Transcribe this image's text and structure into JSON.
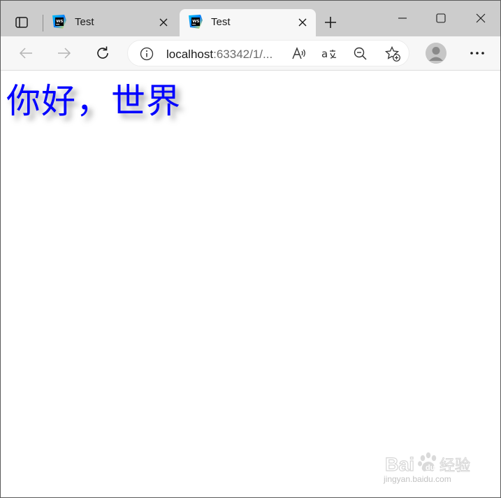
{
  "browser": {
    "tabs": [
      {
        "title": "Test",
        "active": false
      },
      {
        "title": "Test",
        "active": true
      }
    ],
    "address_bar": {
      "url_host": "localhost",
      "url_rest": ":63342/1/..."
    },
    "icons": {
      "tab_actions": "tab-actions-icon",
      "favicon": "webstorm-icon",
      "tab_close": "close-icon",
      "new_tab": "plus-icon",
      "minimize": "minimize-icon",
      "maximize": "maximize-icon",
      "close_window": "close-icon",
      "back": "arrow-left-icon",
      "forward": "arrow-right-icon",
      "refresh": "refresh-icon",
      "site_info": "info-icon",
      "read_aloud": "read-aloud-icon",
      "translate": "translate-icon",
      "zoom": "zoom-out-icon",
      "favorites": "add-favorite-icon",
      "profile": "profile-icon",
      "more": "more-icon"
    },
    "colors": {
      "tabstrip": "#cccccc",
      "active_tab": "#f7f7f7",
      "accent_text": "#0000ff"
    }
  },
  "page": {
    "heading": "你好，世界"
  },
  "watermark": {
    "brand": "Baidu经验",
    "url": "jingyan.baidu.com"
  }
}
